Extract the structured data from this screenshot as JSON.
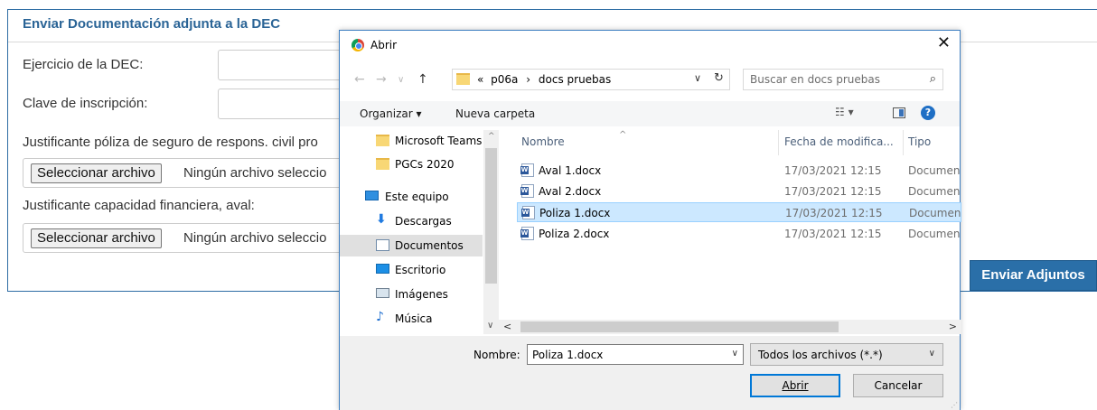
{
  "form": {
    "title": "Enviar Documentación adjunta a la DEC",
    "ejercicio_label": "Ejercicio de la DEC:",
    "clave_label": "Clave de inscripción:",
    "poliza_label": "Justificante póliza de seguro de respons. civil pro",
    "file_button": "Seleccionar archivo",
    "file_none": "Ningún archivo seleccio",
    "aval_label": "Justificante capacidad financiera, aval:",
    "submit_label": "Enviar Adjuntos",
    "accent_color": "#2a6fa8"
  },
  "dialog": {
    "title": "Abrir",
    "close_glyph": "✕",
    "address": {
      "prefix": "«",
      "crumb1": "p06a",
      "sep": "›",
      "crumb2": "docs pruebas"
    },
    "search_placeholder": "Buscar en docs pruebas",
    "toolbar": {
      "organize": "Organizar ▾",
      "new_folder": "Nueva carpeta",
      "help": "?"
    },
    "nav": [
      {
        "label": "Microsoft Teams",
        "icon": "folder-icon"
      },
      {
        "label": "PGCs 2020",
        "icon": "folder-icon"
      },
      {
        "label": "Este equipo",
        "icon": "computer-icon"
      },
      {
        "label": "Descargas",
        "icon": "download-icon"
      },
      {
        "label": "Documentos",
        "icon": "documents-icon"
      },
      {
        "label": "Escritorio",
        "icon": "desktop-icon"
      },
      {
        "label": "Imágenes",
        "icon": "pictures-icon"
      },
      {
        "label": "Música",
        "icon": "music-icon"
      }
    ],
    "columns": {
      "name": "Nombre",
      "date": "Fecha de modifica...",
      "type": "Tipo"
    },
    "files": [
      {
        "name": "Aval 1.docx",
        "date": "17/03/2021 12:15",
        "type": "Documen"
      },
      {
        "name": "Aval 2.docx",
        "date": "17/03/2021 12:15",
        "type": "Documen"
      },
      {
        "name": "Poliza 1.docx",
        "date": "17/03/2021 12:15",
        "type": "Documen"
      },
      {
        "name": "Poliza 2.docx",
        "date": "17/03/2021 12:15",
        "type": "Documen"
      }
    ],
    "selected_file_index": 2,
    "filename_label": "Nombre:",
    "filename_value": "Poliza 1.docx",
    "filetype_value": "Todos los archivos (*.*)",
    "open_button": "Abrir",
    "cancel_button": "Cancelar"
  }
}
